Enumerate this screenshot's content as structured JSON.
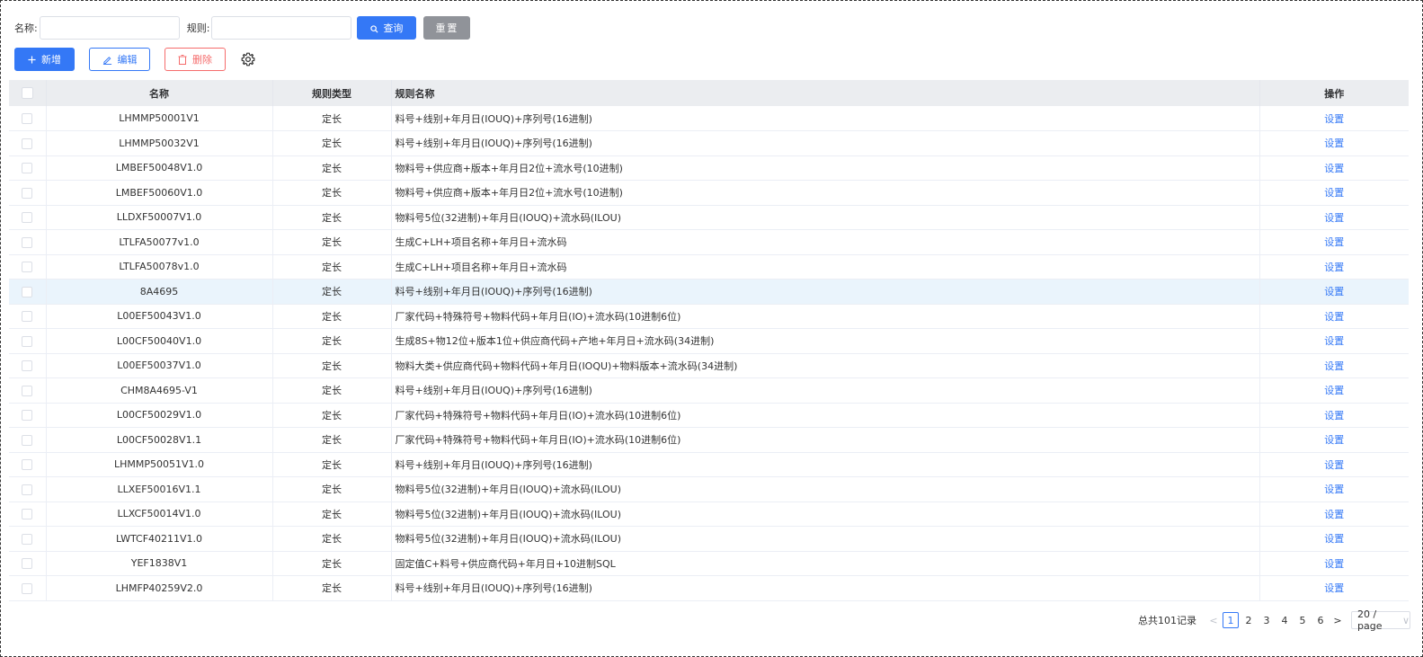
{
  "search": {
    "name_label": "名称:",
    "rule_label": "规则:",
    "name_value": "",
    "rule_value": "",
    "query_label": "查询",
    "reset_label": "重置"
  },
  "toolbar": {
    "add_label": "新增",
    "edit_label": "编辑",
    "delete_label": "删除"
  },
  "table": {
    "headers": {
      "name": "名称",
      "rule_type": "规则类型",
      "rule_name": "规则名称",
      "action": "操作"
    },
    "rows": [
      {
        "name": "LHMMP50001V1",
        "type": "定长",
        "rule": "料号+线别+年月日(IOUQ)+序列号(16进制)",
        "action": "设置"
      },
      {
        "name": "LHMMP50032V1",
        "type": "定长",
        "rule": "料号+线别+年月日(IOUQ)+序列号(16进制)",
        "action": "设置"
      },
      {
        "name": "LMBEF50048V1.0",
        "type": "定长",
        "rule": "物料号+供应商+版本+年月日2位+流水号(10进制)",
        "action": "设置"
      },
      {
        "name": "LMBEF50060V1.0",
        "type": "定长",
        "rule": "物料号+供应商+版本+年月日2位+流水号(10进制)",
        "action": "设置"
      },
      {
        "name": "LLDXF50007V1.0",
        "type": "定长",
        "rule": "物料号5位(32进制)+年月日(IOUQ)+流水码(ILOU)",
        "action": "设置"
      },
      {
        "name": "LTLFA50077v1.0",
        "type": "定长",
        "rule": "生成C+LH+项目名称+年月日+流水码",
        "action": "设置"
      },
      {
        "name": "LTLFA50078v1.0",
        "type": "定长",
        "rule": "生成C+LH+项目名称+年月日+流水码",
        "action": "设置"
      },
      {
        "name": "8A4695",
        "type": "定长",
        "rule": "料号+线别+年月日(IOUQ)+序列号(16进制)",
        "action": "设置"
      },
      {
        "name": "L00EF50043V1.0",
        "type": "定长",
        "rule": "厂家代码+特殊符号+物料代码+年月日(IO)+流水码(10进制6位)",
        "action": "设置"
      },
      {
        "name": "L00CF50040V1.0",
        "type": "定长",
        "rule": "生成8S+物12位+版本1位+供应商代码+产地+年月日+流水码(34进制)",
        "action": "设置"
      },
      {
        "name": "L00EF50037V1.0",
        "type": "定长",
        "rule": "物料大类+供应商代码+物料代码+年月日(IOQU)+物料版本+流水码(34进制)",
        "action": "设置"
      },
      {
        "name": "CHM8A4695-V1",
        "type": "定长",
        "rule": "料号+线别+年月日(IOUQ)+序列号(16进制)",
        "action": "设置"
      },
      {
        "name": "L00CF50029V1.0",
        "type": "定长",
        "rule": "厂家代码+特殊符号+物料代码+年月日(IO)+流水码(10进制6位)",
        "action": "设置"
      },
      {
        "name": "L00CF50028V1.1",
        "type": "定长",
        "rule": "厂家代码+特殊符号+物料代码+年月日(IO)+流水码(10进制6位)",
        "action": "设置"
      },
      {
        "name": "LHMMP50051V1.0",
        "type": "定长",
        "rule": "料号+线别+年月日(IOUQ)+序列号(16进制)",
        "action": "设置"
      },
      {
        "name": "LLXEF50016V1.1",
        "type": "定长",
        "rule": "物料号5位(32进制)+年月日(IOUQ)+流水码(ILOU)",
        "action": "设置"
      },
      {
        "name": "LLXCF50014V1.0",
        "type": "定长",
        "rule": "物料号5位(32进制)+年月日(IOUQ)+流水码(ILOU)",
        "action": "设置"
      },
      {
        "name": "LWTCF40211V1.0",
        "type": "定长",
        "rule": "物料号5位(32进制)+年月日(IOUQ)+流水码(ILOU)",
        "action": "设置"
      },
      {
        "name": "YEF1838V1",
        "type": "定长",
        "rule": "固定值C+料号+供应商代码+年月日+10进制SQL",
        "action": "设置"
      },
      {
        "name": "LHMFP40259V2.0",
        "type": "定长",
        "rule": "料号+线别+年月日(IOUQ)+序列号(16进制)",
        "action": "设置"
      }
    ]
  },
  "pagination": {
    "total": "总共101记录",
    "pages": [
      "1",
      "2",
      "3",
      "4",
      "5",
      "6"
    ],
    "current": "1",
    "page_size": "20 / page",
    "prev": "<",
    "next": ">"
  },
  "icons": {
    "query": "search-icon",
    "add": "plus-icon",
    "edit": "edit-icon",
    "delete": "trash-icon",
    "settings": "gear-icon"
  },
  "colors": {
    "primary": "#3478f6",
    "danger": "#f56c6c",
    "reset": "#909399",
    "header_bg": "#ebedf0",
    "highlight_row": "#eaf4fc"
  }
}
